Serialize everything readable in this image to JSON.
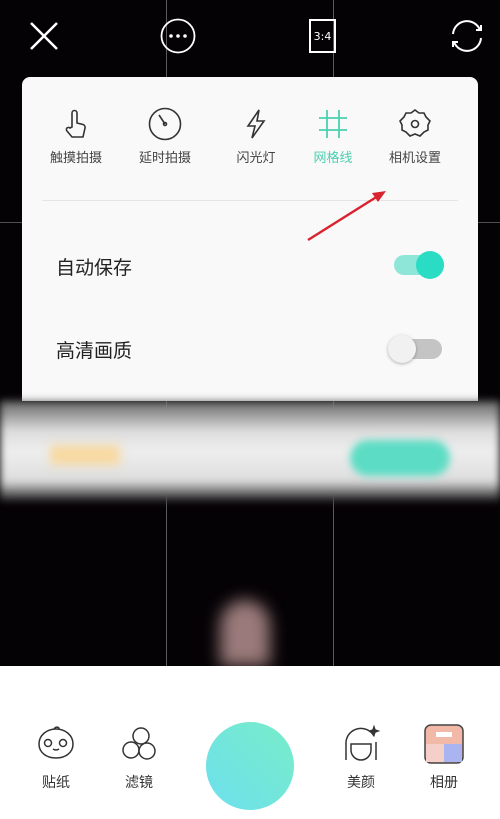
{
  "top_bar": {
    "close_icon": "close-icon",
    "more_icon": "more-icon",
    "ratio": "3:4",
    "switch_camera_icon": "camera-switch-icon"
  },
  "panel": {
    "tools": [
      {
        "label": "触摸拍摄",
        "icon": "touch-icon"
      },
      {
        "label": "延时拍摄",
        "icon": "timer-icon"
      },
      {
        "label": "闪光灯",
        "icon": "flash-icon"
      },
      {
        "label": "网格线",
        "icon": "grid-icon",
        "active": true
      },
      {
        "label": "相机设置",
        "icon": "gear-icon"
      }
    ],
    "settings": [
      {
        "label": "自动保存",
        "on": true
      },
      {
        "label": "高清画质",
        "on": false
      }
    ]
  },
  "bottom": {
    "items": [
      {
        "label": "贴纸"
      },
      {
        "label": "滤镜"
      },
      {
        "label": "美颜"
      },
      {
        "label": "相册"
      }
    ]
  },
  "colors": {
    "accent": "#4ccfb0",
    "toggle_on": "#2bdcc4",
    "annotation_arrow": "#d9232e"
  }
}
